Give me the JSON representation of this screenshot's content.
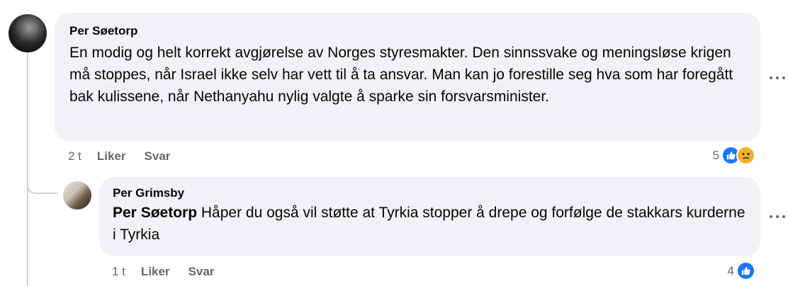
{
  "comments": [
    {
      "author": "Per Søetorp",
      "text": "En modig og helt korrekt avgjørelse av Norges styresmakter. Den sinnssvake og meningsløse krigen må stoppes, når Israel ikke selv har vett til å ta ansvar. Man kan jo forestille seg hva som har foregått bak kulissene, når Nethanyahu nylig valgte å sparke sin forsvarsminister.",
      "time": "2 t",
      "like_label": "Liker",
      "reply_label": "Svar",
      "reaction_count": "5",
      "reactions": [
        "like-icon",
        "sad-icon"
      ]
    }
  ],
  "reply": {
    "author": "Per Grimsby",
    "mention": "Per Søetorp",
    "text": " Håper du også vil støtte at Tyrkia stopper å drepe og forfølge de stakkars kurderne i Tyrkia",
    "time": "1 t",
    "like_label": "Liker",
    "reply_label": "Svar",
    "reaction_count": "4",
    "reactions": [
      "like-icon"
    ]
  },
  "colors": {
    "bubble": "#f0f2f5",
    "like_blue": "#1877f2",
    "secondary_text": "#65676b"
  }
}
